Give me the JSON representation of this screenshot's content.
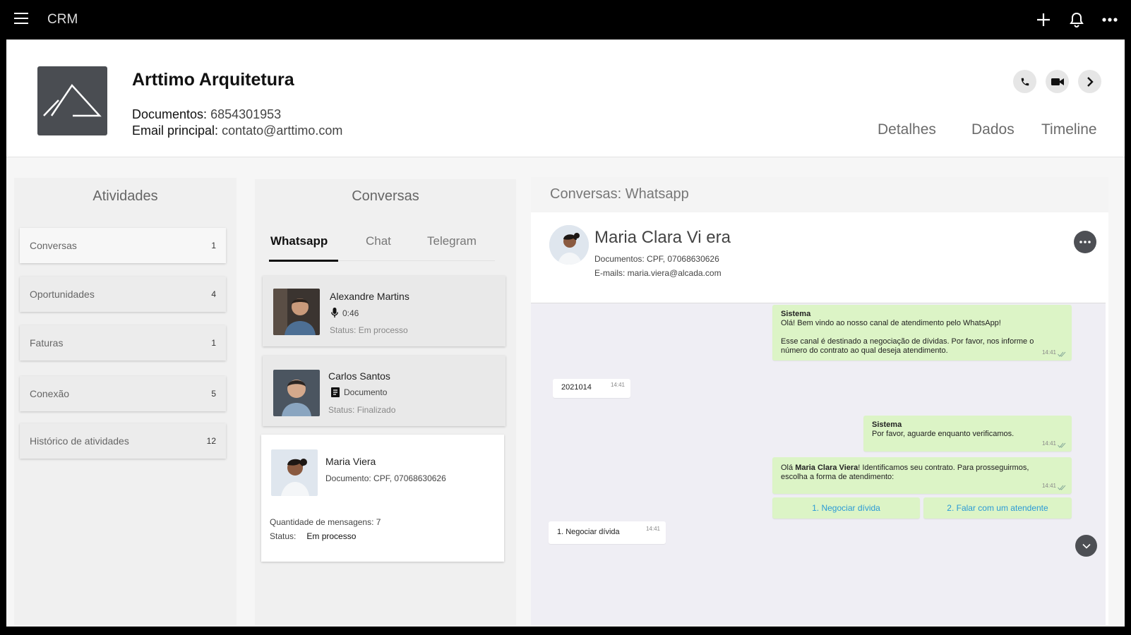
{
  "app": {
    "title": "CRM"
  },
  "topbar": {
    "add_icon": "plus-icon",
    "bell_icon": "bell-icon",
    "more_icon": "more-horizontal-icon"
  },
  "company": {
    "name": "Arttimo Arquitetura",
    "documents_label": "Documentos:",
    "documents_value": "6854301953",
    "email_label": "Email principal:",
    "email_value": "contato@arttimo.com"
  },
  "header_actions": [
    "phone-icon",
    "video-icon",
    "chevron-right-icon"
  ],
  "header_tabs": [
    "Detalhes",
    "Dados",
    "Timeline"
  ],
  "activities": {
    "title": "Atividades",
    "items": [
      {
        "label": "Conversas",
        "count": "1"
      },
      {
        "label": "Oportunidades",
        "count": "4"
      },
      {
        "label": "Faturas",
        "count": "1"
      },
      {
        "label": "Conexão",
        "count": "5"
      },
      {
        "label": "Histórico de atividades",
        "count": "12"
      }
    ]
  },
  "conversations": {
    "title": "Conversas",
    "tabs": [
      "Whatsapp",
      "Chat",
      "Telegram"
    ],
    "active_tab": "Whatsapp",
    "list": [
      {
        "name": "Alexandre Martins",
        "detail": "0:46",
        "detail_icon": "microphone-icon",
        "status": "Status: Em processo"
      },
      {
        "name": "Carlos Santos",
        "detail": "Documento",
        "detail_icon": "document-icon",
        "status": "Status: Finalizado"
      },
      {
        "name": "Maria Viera",
        "detail": "Documento: CPF, 07068630626",
        "messages_label": "Quantidade de mensagens: 7",
        "status_label": "Status:",
        "status_value": "Em processo"
      }
    ]
  },
  "chat": {
    "title": "Conversas: Whatsapp",
    "contact_name": "Maria Clara Vi era",
    "contact_docs": "Documentos: CPF, 07068630626",
    "contact_emails": "E-mails: maria.viera@alcada.com",
    "messages": [
      {
        "sender": "Sistema",
        "text1": "Olá! Bem vindo ao nosso canal de atendimento pelo WhatsApp!",
        "text2": "Esse canal é destinado a negociação de dívidas. Por favor, nos informe o",
        "text3": "número do contrato ao qual deseja atendimento.",
        "time": "14:41"
      },
      {
        "text": "2021014",
        "time": "14:41"
      },
      {
        "sender": "Sistema",
        "text": "Por favor, aguarde enquanto verificamos.",
        "time": "14:41"
      },
      {
        "pre": "Olá ",
        "bold": "Maria Clara Viera",
        "post": "! Identificamos seu contrato. Para prosseguirmos,",
        "line2": "escolha a forma de atendimento:",
        "time": "14:41"
      },
      {
        "text": "1. Negociar dívida",
        "time": "14:41"
      }
    ],
    "options": [
      "1. Negociar dívida",
      "2. Falar com um atendente"
    ]
  }
}
